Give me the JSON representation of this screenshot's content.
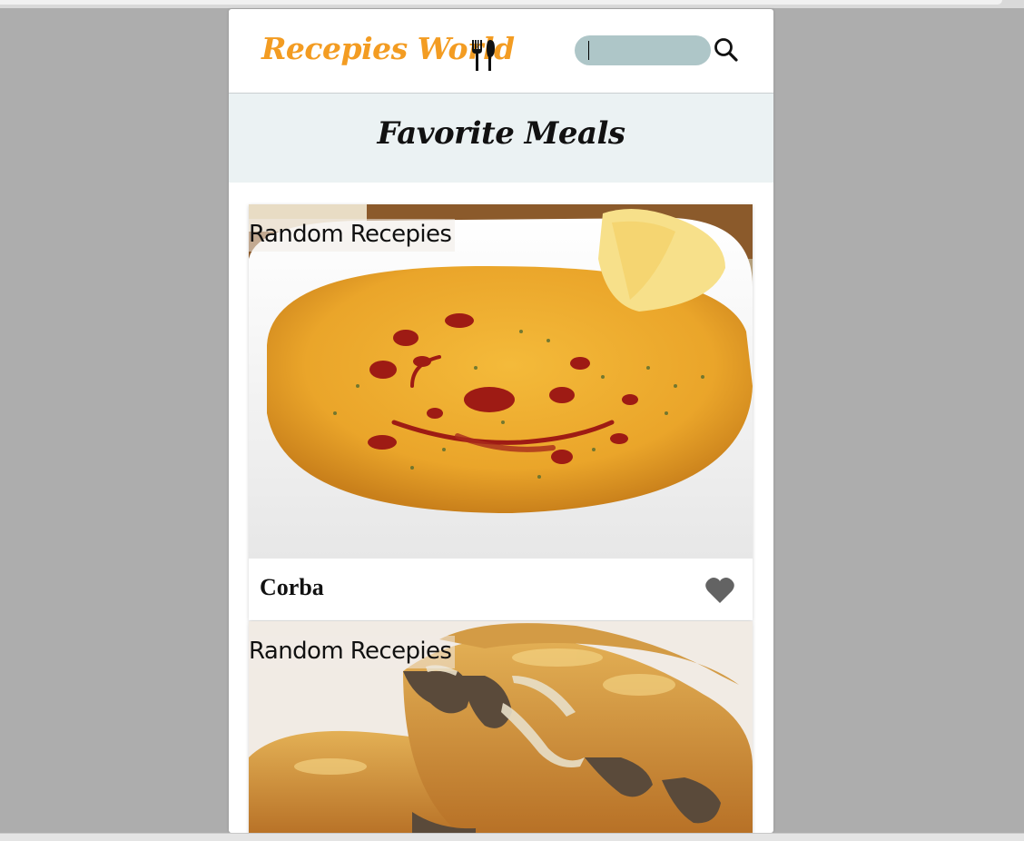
{
  "app": {
    "logo_text": "Recepies World",
    "logo_icon": "utensils-icon",
    "accent_color": "#f39c22"
  },
  "search": {
    "value": "",
    "placeholder": "",
    "icon": "search-icon"
  },
  "favorites": {
    "title": "Favorite Meals"
  },
  "meals": [
    {
      "tag": "Random Recepies",
      "name": "Corba",
      "image": "lentil soup in white bowl with red pepper oil swirl and lemon wedge",
      "favorite_icon": "heart-icon"
    },
    {
      "tag": "Random Recepies",
      "image": "meat-filled flaky pastry pie (burek) slices"
    }
  ]
}
